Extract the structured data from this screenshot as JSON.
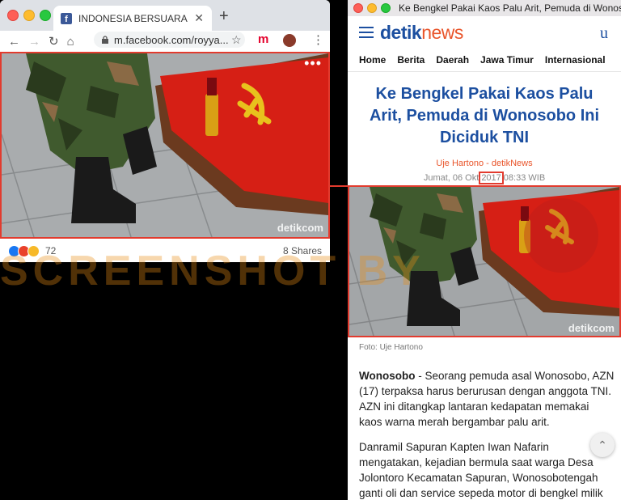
{
  "left_browser": {
    "tab_title": "INDONESIA BERSUARA",
    "favicon": "facebook-icon",
    "url": "m.facebook.com/royya...",
    "reactions_count": "72",
    "shares": "8 Shares",
    "photo_watermark": "detikcom"
  },
  "right_browser": {
    "window_title": "Ke Bengkel Pakai Kaos Palu Arit, Pemuda di Wonosobo...",
    "logo_main": "detik",
    "logo_accent": "news",
    "user_icon": "u",
    "menu": [
      "Home",
      "Berita",
      "Daerah",
      "Jawa Timur",
      "Internasional"
    ],
    "headline": "Ke Bengkel Pakai Kaos Palu Arit, Pemuda di Wonosobo Ini Diciduk TNI",
    "author": "Uje Hartono - detikNews",
    "date_prefix": "Jumat, 06 Okt",
    "date_year": "2017",
    "date_suffix": "08:33 WIB",
    "photo_watermark": "detikcom",
    "caption": "Foto: Uje Hartono",
    "para1_lead": "Wonosobo",
    "para1_rest": " - Seorang pemuda asal Wonosobo, AZN (17) terpaksa harus berurusan dengan anggota TNI. AZN ini ditangkap lantaran kedapatan memakai kaos warna merah bergambar palu arit.",
    "para2": "Danramil Sapuran Kapten Iwan Nafarin mengatakan, kejadian bermula saat warga Desa Jolontoro Kecamatan Sapuran, Wonosobotengah ganti oli dan service sepeda motor di bengkel milik Jupri di"
  },
  "overlay_watermark": "SCREENSHOT BY",
  "colors": {
    "highlight": "#e23b2e",
    "detik_blue": "#1c4fa0",
    "detik_orange": "#e9552b"
  }
}
